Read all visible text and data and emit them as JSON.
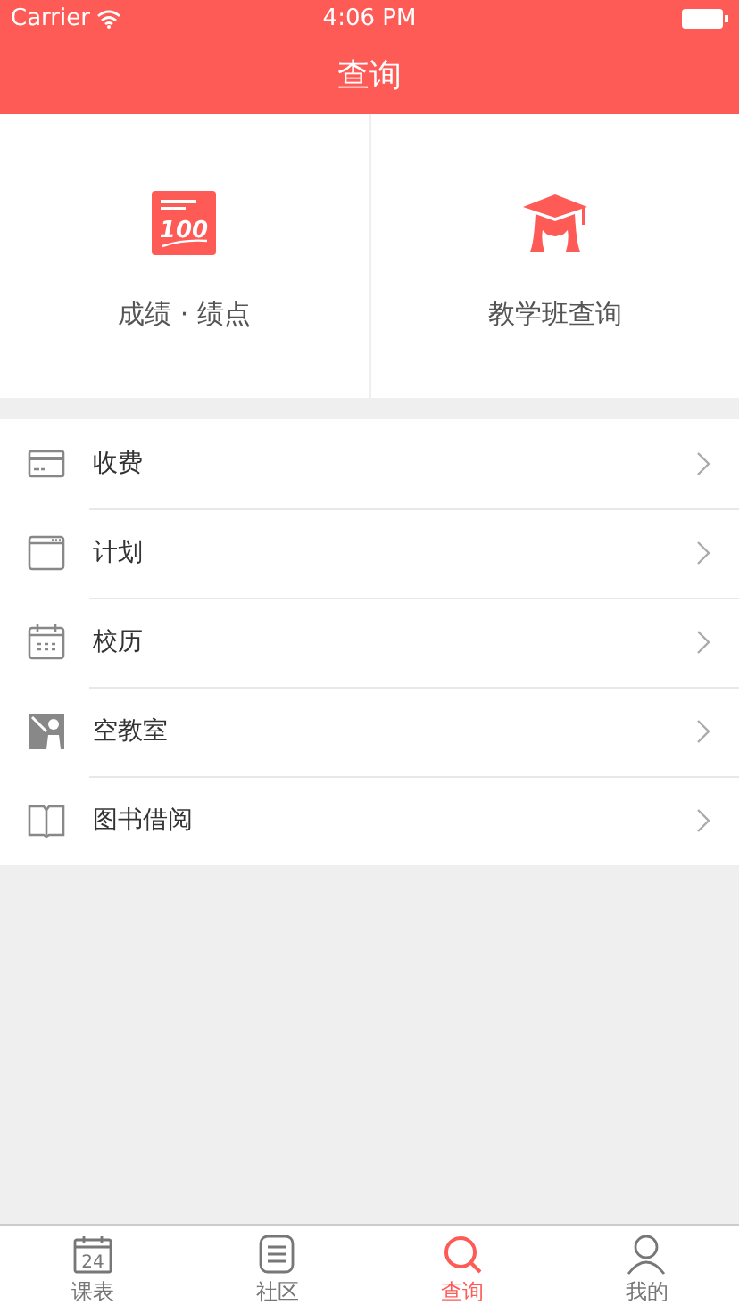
{
  "status_bar": {
    "carrier": "Carrier",
    "time": "4:06 PM"
  },
  "nav": {
    "title": "查询"
  },
  "tiles": [
    {
      "kind": "score",
      "label": "成绩 · 绩点",
      "icon_text": "100"
    },
    {
      "kind": "teacher",
      "label": "教学班查询"
    }
  ],
  "menu": [
    {
      "kind": "card",
      "label": "收费"
    },
    {
      "kind": "window",
      "label": "计划"
    },
    {
      "kind": "calendar",
      "label": "校历"
    },
    {
      "kind": "classroom",
      "label": "空教室"
    },
    {
      "kind": "book",
      "label": "图书借阅"
    }
  ],
  "tabbar": [
    {
      "kind": "calendar",
      "label": "课表",
      "selected": false,
      "icon_text": "24"
    },
    {
      "kind": "list",
      "label": "社区",
      "selected": false
    },
    {
      "kind": "search",
      "label": "查询",
      "selected": true
    },
    {
      "kind": "person",
      "label": "我的",
      "selected": false
    }
  ]
}
